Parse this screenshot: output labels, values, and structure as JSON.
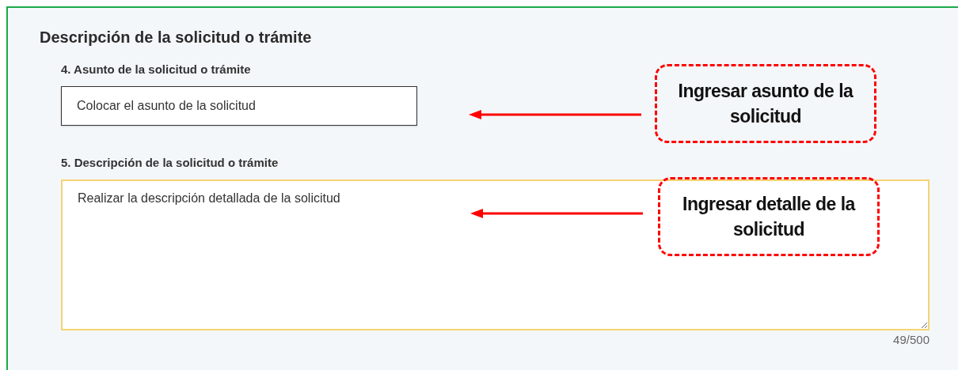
{
  "section": {
    "title": "Descripción de la solicitud o trámite"
  },
  "fields": [
    {
      "kind": "input",
      "label": "4. Asunto de la solicitud o trámite",
      "value": "Colocar el asunto de la solicitud",
      "focused": false
    },
    {
      "kind": "textarea",
      "label": "5. Descripción de la solicitud o trámite",
      "value": "Realizar la descripción detallada de la solicitud",
      "focused": true,
      "counter": "49/500"
    }
  ],
  "annotations": [
    {
      "text": "Ingresar asunto de la solicitud"
    },
    {
      "text": "Ingresar detalle de la solicitud"
    }
  ]
}
